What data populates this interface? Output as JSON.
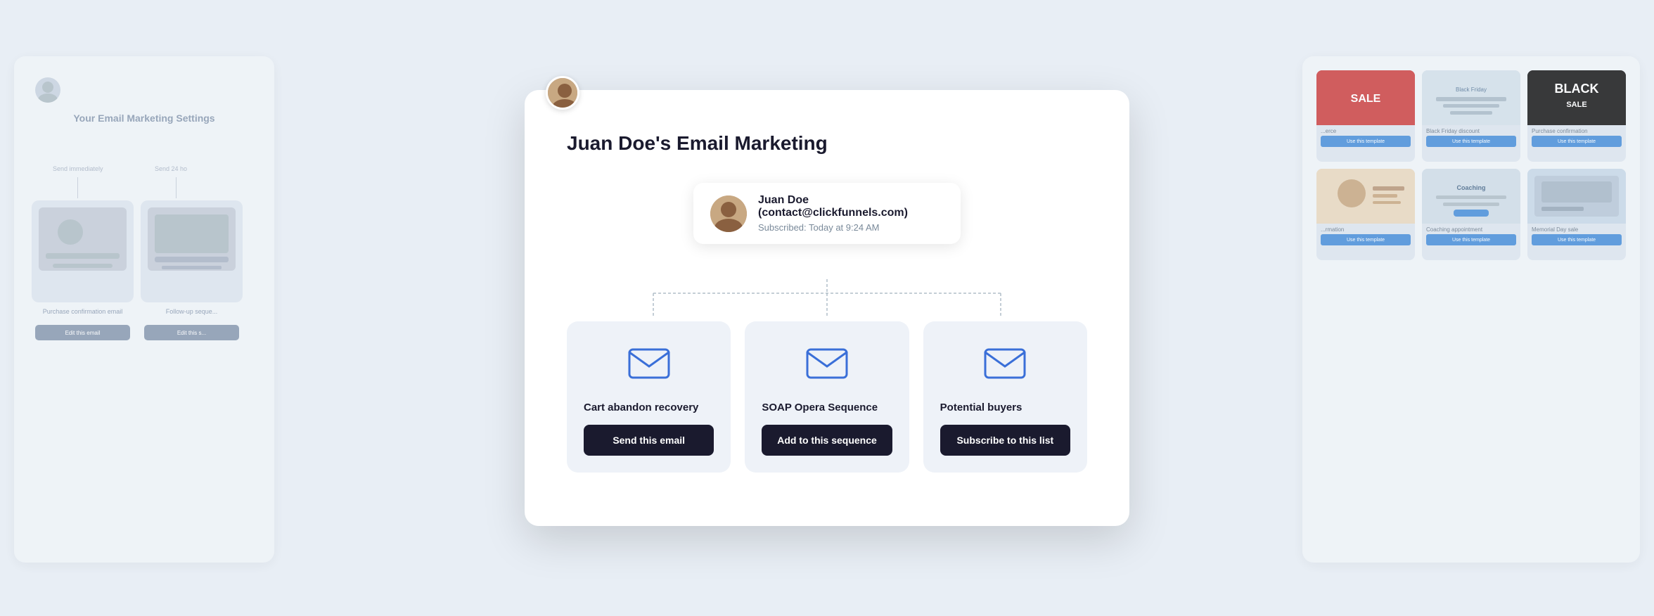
{
  "modal": {
    "title": "Juan Doe's Email Marketing",
    "avatar_alt": "User avatar"
  },
  "contact": {
    "name": "Juan Doe (contact@clickfunnels.com)",
    "subscribed": "Subscribed: Today at 9:24 AM"
  },
  "actions": [
    {
      "id": "cart-abandon",
      "title": "Cart abandon recovery",
      "button_label": "Send this email",
      "icon": "envelope-icon"
    },
    {
      "id": "soap-opera",
      "title": "SOAP Opera Sequence",
      "button_label": "Add to this sequence",
      "icon": "envelope-icon"
    },
    {
      "id": "potential-buyers",
      "title": "Potential buyers",
      "button_label": "Subscribe to this list",
      "icon": "envelope-icon"
    }
  ],
  "left_panel": {
    "title": "Your Email Marketing Settings",
    "label1": "Send immediately",
    "label2": "Send 24 ho",
    "card1_label": "Purchase confirmation email",
    "card2_label": "Follow-up seque...",
    "btn1": "Edit this email",
    "btn2": "Edit this s..."
  },
  "right_panel": {
    "cards": [
      {
        "label": "...erce",
        "btn": "Use this template"
      },
      {
        "label": "Black Friday discount",
        "btn": "Use this template"
      },
      {
        "label": "Purchase confirmation",
        "btn": "Use this template"
      },
      {
        "label": "...rmation",
        "btn": "Use this template"
      },
      {
        "label": "Coaching appointment",
        "btn": "Use this template"
      },
      {
        "label": "Memorial Day sale",
        "btn": "Use this template"
      }
    ]
  }
}
